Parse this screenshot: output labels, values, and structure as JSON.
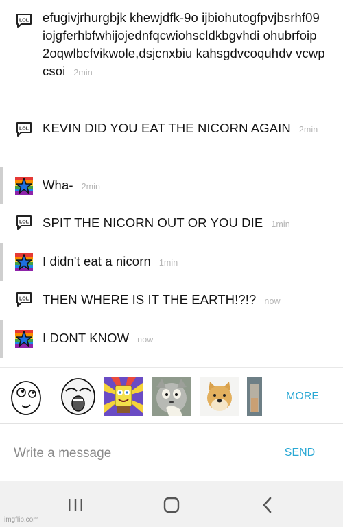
{
  "messages": [
    {
      "avatar": "lol-speech-bubble-icon",
      "text": "efugivjrhurgbjk khewjdfk-9o ijbiohutogfpvjbsrhf09 iojgferhbfwhijojednfqcwiohscldkbgvhdi ohubrfoip 2oqwlbcfvikwole,dsjcnxbiu kahsgdvcoquhdv vcwp csoi",
      "time": "2min"
    },
    {
      "avatar": "lol-speech-bubble-icon",
      "text": "KEVIN DID YOU EAT THE NICORN AGAIN",
      "time": "2min"
    },
    {
      "avatar": "rainbow-star-icon",
      "text": "Wha-",
      "time": "2min"
    },
    {
      "avatar": "lol-speech-bubble-icon",
      "text": "SPIT THE NICORN OUT OR YOU DIE",
      "time": "1min"
    },
    {
      "avatar": "rainbow-star-icon",
      "text": "I didn't eat a nicorn",
      "time": "1min"
    },
    {
      "avatar": "lol-speech-bubble-icon",
      "text": "THEN WHERE IS IT THE EARTH!?!?",
      "time": "now"
    },
    {
      "avatar": "rainbow-star-icon",
      "text": "I DONT KNOW",
      "time": "now"
    }
  ],
  "stickers": [
    "derp-rage-face",
    "lol-rage-face",
    "imagination-spongebob",
    "unsettled-tom",
    "doge",
    "partial-meme"
  ],
  "more_label": "MORE",
  "composer": {
    "placeholder": "Write a message",
    "send_label": "SEND"
  },
  "navbar": [
    "recent-apps-icon",
    "home-icon",
    "back-icon"
  ],
  "watermark": "imgflip.com",
  "colors": {
    "accent": "#2aa8d4",
    "timestamp": "#b5b5b5",
    "highlight_bar": "#cfcfcf"
  }
}
